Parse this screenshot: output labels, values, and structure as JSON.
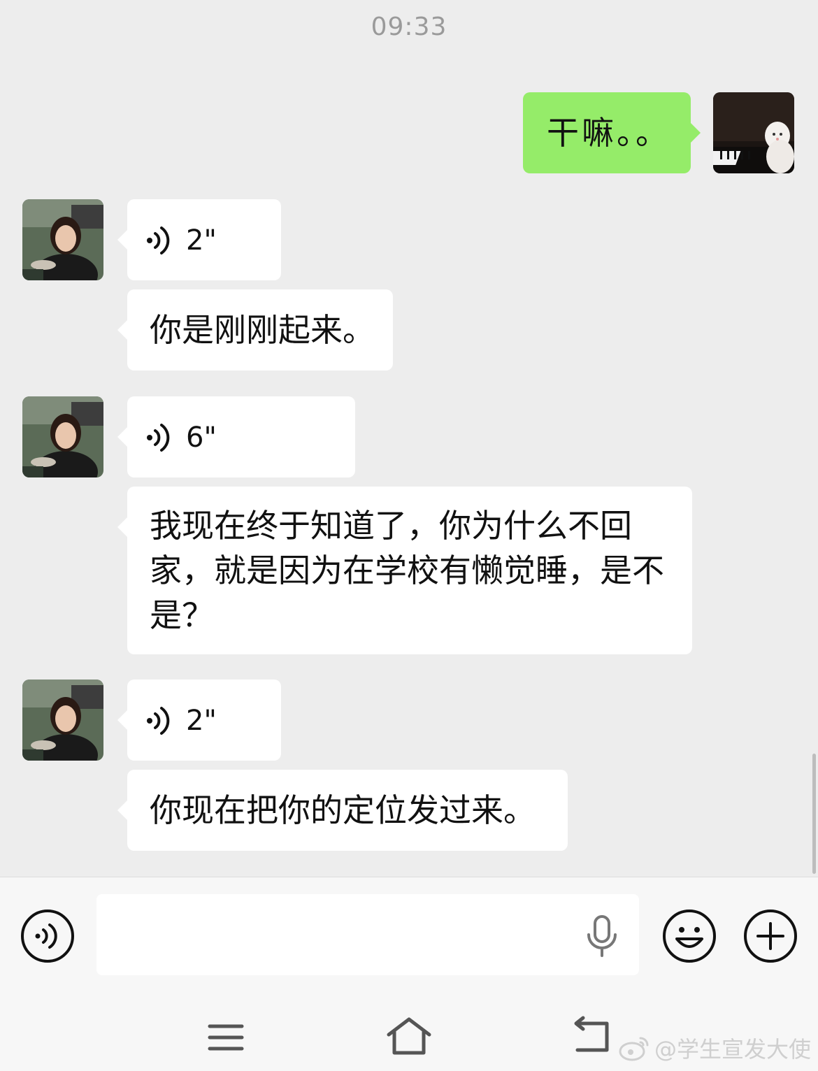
{
  "chat": {
    "timestamp": "09:33",
    "messages": [
      {
        "side": "right",
        "type": "text",
        "text": "干嘛。。"
      },
      {
        "side": "left",
        "type": "voice",
        "duration": "2\""
      },
      {
        "side": "left",
        "type": "text",
        "text": "你是刚刚起来。"
      },
      {
        "side": "left",
        "type": "voice",
        "duration": "6\""
      },
      {
        "side": "left",
        "type": "text",
        "text": "我现在终于知道了，你为什么不回家，就是因为在学校有懒觉睡，是不是？"
      },
      {
        "side": "left",
        "type": "voice",
        "duration": "2\""
      },
      {
        "side": "left",
        "type": "text",
        "text": "你现在把你的定位发过来。"
      }
    ]
  },
  "input_bar": {
    "value": "",
    "icons": {
      "voice_toggle": "voice-toggle-icon",
      "mic": "microphone-icon",
      "emoji": "emoji-icon",
      "more": "plus-icon"
    }
  },
  "nav_bar": {
    "icons": [
      "menu-icon",
      "home-icon",
      "back-icon"
    ]
  },
  "watermark": {
    "text": "@学生宣发大使"
  },
  "colors": {
    "background": "#ededed",
    "sent_bubble": "#95ec69",
    "received_bubble": "#ffffff",
    "timestamp": "#9a9a9a"
  }
}
